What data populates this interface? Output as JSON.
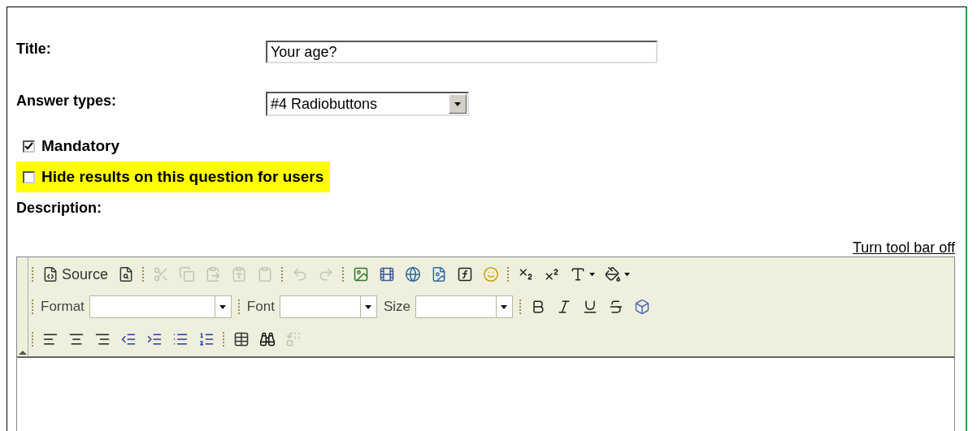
{
  "form": {
    "title_label": "Title:",
    "title_value": "Your age?",
    "answer_label": "Answer types:",
    "answer_value": "#4 Radiobuttons",
    "checkboxes": [
      {
        "label": "Mandatory",
        "checked": true,
        "highlighted": false
      },
      {
        "label": "Hide results on this question for users",
        "checked": false,
        "highlighted": true
      }
    ],
    "description_label": "Description:",
    "toolbar_toggle": "Turn tool bar off"
  },
  "toolbar": {
    "rows": [
      [
        {
          "kind": "button",
          "label": "Source",
          "disabled": false
        },
        {
          "kind": "button",
          "disabled": false
        },
        {
          "kind": "separator"
        },
        {
          "kind": "button",
          "disabled": true
        },
        {
          "kind": "button",
          "disabled": true
        },
        {
          "kind": "button",
          "disabled": true
        },
        {
          "kind": "button",
          "disabled": true
        },
        {
          "kind": "button",
          "disabled": true
        },
        {
          "kind": "separator"
        },
        {
          "kind": "button",
          "disabled": true
        },
        {
          "kind": "button",
          "disabled": true
        },
        {
          "kind": "separator"
        },
        {
          "kind": "button",
          "disabled": false
        },
        {
          "kind": "button",
          "disabled": false
        },
        {
          "kind": "button",
          "disabled": false
        },
        {
          "kind": "button",
          "disabled": false
        },
        {
          "kind": "button",
          "disabled": false
        },
        {
          "kind": "button",
          "disabled": false
        },
        {
          "kind": "separator"
        },
        {
          "kind": "button",
          "disabled": false
        },
        {
          "kind": "button",
          "disabled": false
        },
        {
          "kind": "menu",
          "disabled": false
        },
        {
          "kind": "menu",
          "disabled": false
        }
      ],
      [
        {
          "kind": "combo",
          "label": "Format"
        },
        {
          "kind": "separator"
        },
        {
          "kind": "combo",
          "label": "Font"
        },
        {
          "kind": "combo",
          "label": "Size"
        },
        {
          "kind": "separator"
        },
        {
          "kind": "button",
          "disabled": false
        },
        {
          "kind": "button",
          "disabled": false
        },
        {
          "kind": "button",
          "disabled": false
        },
        {
          "kind": "button",
          "disabled": false
        },
        {
          "kind": "button",
          "disabled": false
        }
      ],
      [
        {
          "kind": "button",
          "disabled": false
        },
        {
          "kind": "button",
          "disabled": false
        },
        {
          "kind": "button",
          "disabled": false
        },
        {
          "kind": "button",
          "disabled": false
        },
        {
          "kind": "button",
          "disabled": false
        },
        {
          "kind": "button",
          "disabled": false
        },
        {
          "kind": "button",
          "disabled": false
        },
        {
          "kind": "separator"
        },
        {
          "kind": "button",
          "disabled": false
        },
        {
          "kind": "button",
          "disabled": false
        },
        {
          "kind": "button",
          "disabled": true
        }
      ]
    ]
  }
}
